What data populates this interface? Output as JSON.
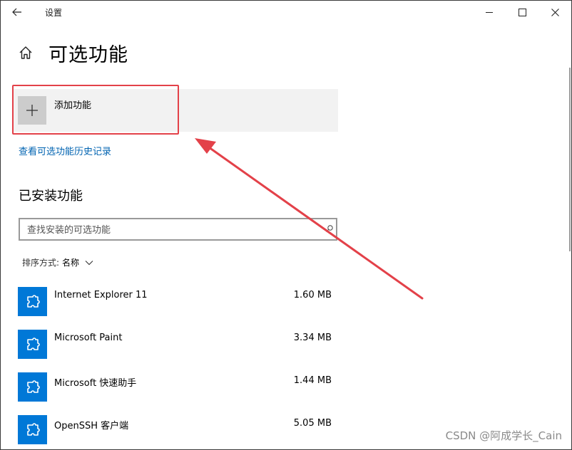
{
  "window": {
    "title": "设置",
    "back_icon": "arrow-left-icon",
    "controls": [
      "minimize-icon",
      "maximize-icon",
      "close-icon"
    ]
  },
  "header": {
    "home_icon": "home-icon",
    "title": "可选功能"
  },
  "add_feature": {
    "label": "添加功能",
    "icon": "plus-icon"
  },
  "history_link": "查看可选功能历史记录",
  "installed": {
    "section_title": "已安装功能",
    "search": {
      "placeholder": "查找安装的可选功能",
      "value": "",
      "icon": "search-icon"
    },
    "sort": {
      "label": "排序方式:",
      "value": "名称",
      "icon": "chevron-down-icon"
    },
    "features": [
      {
        "name": "Internet Explorer 11",
        "size": "1.60 MB",
        "icon": "puzzle-piece-icon"
      },
      {
        "name": "Microsoft Paint",
        "size": "3.34 MB",
        "icon": "puzzle-piece-icon"
      },
      {
        "name": "Microsoft 快速助手",
        "size": "1.44 MB",
        "icon": "puzzle-piece-icon"
      },
      {
        "name": "OpenSSH 客户端",
        "size": "5.05 MB",
        "icon": "puzzle-piece-icon"
      }
    ]
  },
  "annotation": {
    "highlight_color": "#e34149",
    "arrow_color": "#e34149"
  },
  "colors": {
    "accent": "#0078d7",
    "link": "#0063b1",
    "panel": "#f2f2f2"
  },
  "watermark": "CSDN @阿成学长_Cain"
}
